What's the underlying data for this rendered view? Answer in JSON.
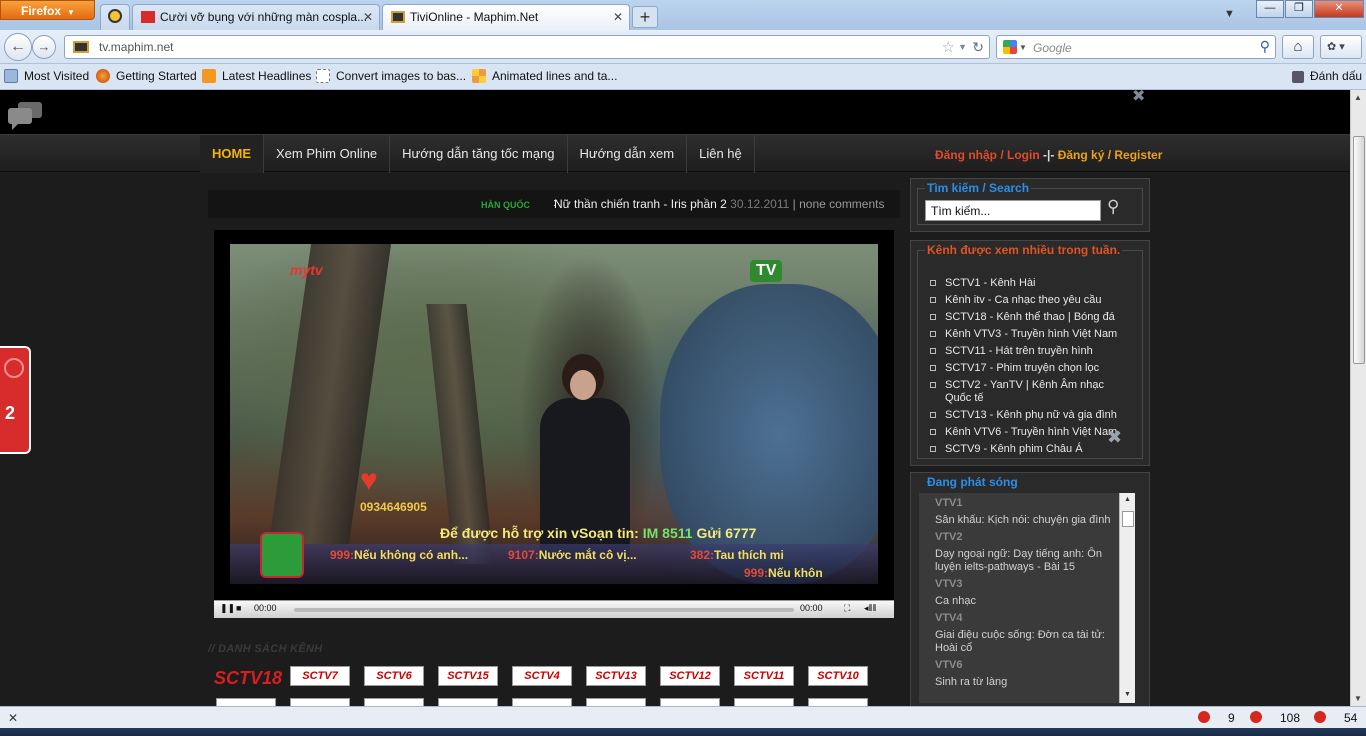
{
  "browser": {
    "app_button": "Firefox",
    "tabs": [
      {
        "title": "Cười vỡ bụng với những màn cospla...",
        "active": false
      },
      {
        "title": "TiviOnline - Maphim.Net",
        "active": true
      }
    ],
    "url": "tv.maphim.net",
    "search_placeholder": "Google",
    "bookmarks": [
      "Most Visited",
      "Getting Started",
      "Latest Headlines",
      "Convert images to bas...",
      "Animated lines and ta..."
    ],
    "bookmarks_right": "Đánh dấu"
  },
  "site": {
    "menu": [
      "HOME",
      "Xem Phim Online",
      "Hướng dẫn tăng tốc mạng",
      "Hướng dẫn xem",
      "Liên hệ"
    ],
    "login": {
      "login": "Đăng nhập / Login",
      "sep": "-|-",
      "register": "Đăng ký / Register"
    },
    "movie": {
      "category": "HÀN QUỐC",
      "title": "Nữ thần chiến tranh - Iris phần 2",
      "date": "30.12.2011",
      "comments": "none comments"
    },
    "video": {
      "logo_left": "mytv",
      "logo_right": "TV",
      "phone": "0934646905",
      "sms_prefix": "Để được hỗ trợ xin vSoạn tin:",
      "sms_code": "IM 8511",
      "sms_suffix": "Gửi 6777",
      "ticker": [
        {
          "num": "999:",
          "text": "Nếu không có anh..."
        },
        {
          "num": "9107:",
          "text": "Nước mắt cô vị..."
        },
        {
          "num": "382:",
          "text": "Tau thích mi"
        },
        {
          "num": "999:",
          "text": "Nếu khôn"
        }
      ],
      "time_current": "00:00",
      "time_total": "00:00"
    },
    "channel_list_title": "// DANH SÁCH KÊNH",
    "channels": [
      "SCTV18",
      "SCTV7",
      "SCTV6",
      "SCTV15",
      "SCTV4",
      "SCTV13",
      "SCTV12",
      "SCTV11",
      "SCTV10"
    ],
    "sidebar": {
      "search": {
        "title": "Tìm kiếm / Search",
        "value": "Tìm kiếm..."
      },
      "popular": {
        "title": "Kênh được xem nhiều trong tuần.",
        "items": [
          "SCTV1 - Kênh Hài",
          "Kênh itv - Ca nhạc theo yêu cầu",
          "SCTV18 - Kênh thể thao | Bóng đá",
          "Kênh VTV3 - Truyền hình Việt Nam",
          "SCTV11 - Hát trên truyền hình",
          "SCTV17 - Phim truyện chọn lọc",
          "SCTV2 - YanTV | Kênh Âm nhạc Quốc tế",
          "SCTV13 - Kênh phụ nữ và gia đình",
          "Kênh VTV6 - Truyền hình Việt Nam",
          "SCTV9 - Kênh phim Châu Á"
        ]
      },
      "live": {
        "title": "Đang phát sóng",
        "entries": [
          {
            "channel": "VTV1",
            "program": "Sân khấu: Kịch nói: chuyện gia đình"
          },
          {
            "channel": "VTV2",
            "program": "Dạy ngoại ngữ: Dạy tiếng anh: Ôn luyện ielts-pathways - Bài 15"
          },
          {
            "channel": "VTV3",
            "program": "Ca nhạc"
          },
          {
            "channel": "VTV4",
            "program": "Giai điệu cuộc sống: Đờn ca tài tử: Hoài cổ"
          },
          {
            "channel": "VTV6",
            "program": "Sinh ra từ làng"
          }
        ]
      }
    },
    "side_badge": "2"
  },
  "statusbar": {
    "counts": [
      "9",
      "108",
      "54"
    ]
  }
}
